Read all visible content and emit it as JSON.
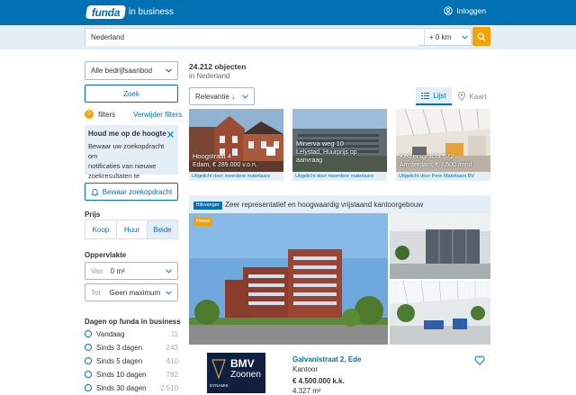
{
  "header": {
    "logo": "funda",
    "subtitle": "in business",
    "login": "Inloggen"
  },
  "search": {
    "value": "Nederland",
    "radius": "+ 0 km"
  },
  "sidebar": {
    "offer_select": "Alle bedrijfsaanbod",
    "search_button": "Zoek",
    "filter_count": "0",
    "filters_label": "filters",
    "clear_filters": "Verwijder filters",
    "alert_title": "Houd me op de hoogte",
    "alert_text_1": "Bewaar uw zoekopdracht om",
    "alert_text_2": "notificaties van nieuwe",
    "alert_text_3": "zoekresultaten te ontvangen.",
    "save_search": "Bewaar zoekopdracht",
    "price_label": "Prijs",
    "price_options": [
      "Koop",
      "Huur",
      "Beide"
    ],
    "area_label": "Oppervlakte",
    "area_from_label": "Van",
    "area_from_value": "0 m²",
    "area_to_label": "Tot",
    "area_to_value": "Geen maximum",
    "days_label": "Dagen op funda in business",
    "days": [
      {
        "label": "Vandaag",
        "count": "11"
      },
      {
        "label": "Sinds 3 dagen",
        "count": "243"
      },
      {
        "label": "Sinds 5 dagen",
        "count": "410"
      },
      {
        "label": "Sinds 10 dagen",
        "count": "782"
      },
      {
        "label": "Sinds 30 dagen",
        "count": "2.510"
      }
    ]
  },
  "results": {
    "count": "24.212 objecten",
    "location": "in Nederland",
    "sort": "Relevantie ↓",
    "view_list": "Lijst",
    "view_map": "Kaart"
  },
  "cards": [
    {
      "title": "Hoogstraat 4",
      "sub": "Edam, € 289.000 v.o.n.",
      "caption": "Uitgelicht door meerdere makelaars"
    },
    {
      "title": "Minerva weg 10",
      "sub1": "Lelystad, Huurprijs op",
      "sub2": "aanvraag",
      "caption": "Uitgelicht door meerdere makelaars"
    },
    {
      "title": "Keizersgracht 572",
      "sub": "Amsterdam, € 7.500 /mnd",
      "caption": "Uitgelicht door Pere Makelaars BV"
    }
  ],
  "featured": {
    "badge": "Blikvanger",
    "title": "Zeer representatief en hoogwaardig vrijstaand kantoorgebouw",
    "new_badge": "Nieuw",
    "address": "Galvanistraat 2, Ede",
    "type": "Kantoor",
    "price": "€ 4.500.000 k.k.",
    "area": "4.327 m²",
    "broker_logo_line1": "BMV",
    "broker_logo_line2": "Zoonen",
    "broker_logo_line3": "DYNAMIS"
  },
  "colors": {
    "brand": "#0071b3",
    "accent": "#f7a100",
    "panel": "#e4eef6"
  }
}
